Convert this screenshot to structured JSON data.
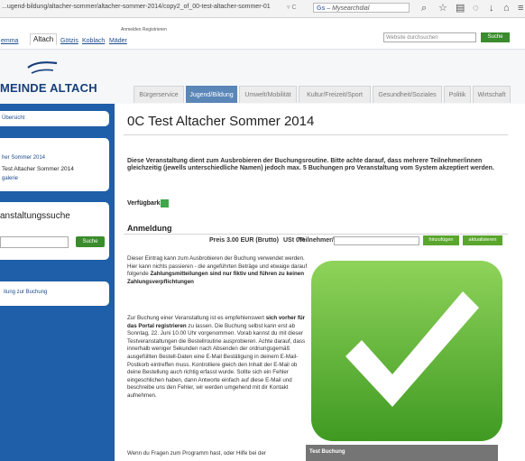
{
  "browser": {
    "url": "...ugend-bildung/altacher-sommer/altacher-sommer-2014/copy2_of_00-test-altacher-sommer-01",
    "search_placeholder": "Mysearchdial",
    "search_prefix": "Gs",
    "addr_controls": "▿ C",
    "toolbar_icons": [
      "search-icon",
      "star-icon",
      "clipboard-icon",
      "shield-icon",
      "download-icon",
      "home-icon",
      "menu-icon"
    ]
  },
  "top_links": {
    "partial": "emma",
    "altach": "Altach",
    "goetzis": "Götzis",
    "koblach": "Koblach",
    "mader": "Mäder",
    "account": "Anmelden   Registrieren",
    "search_placeholder": "Website durchsuchen",
    "search_button": "Suche"
  },
  "logo": {
    "text": "MEINDE ALTACH"
  },
  "nav": [
    {
      "label": "Bürgerservice",
      "active": false
    },
    {
      "label": "Jugend/Bildung",
      "active": true
    },
    {
      "label": "Umwelt/Mobilität",
      "active": false
    },
    {
      "label": "Kultur/Freizeit/Sport",
      "active": false
    },
    {
      "label": "Gesundheit/Soziales",
      "active": false
    },
    {
      "label": "Politik",
      "active": false
    },
    {
      "label": "Wirtschaft",
      "active": false
    }
  ],
  "sidebar": {
    "overview": "Übersicht",
    "items": [
      "her Sommer 2014",
      "Test Altacher Sommer 2014",
      "galerie"
    ],
    "search_title": "anstaltungssuche",
    "search_button": "Suche",
    "guide": "itung zur Buchung"
  },
  "main": {
    "title": "0C Test Altacher Sommer 2014",
    "intro": "Diese Veranstaltung dient zum Ausbrobieren der Buchungsroutine. Bitte achte darauf, dass mehrere Teilnehmer/innen gleichzeitig (jewells unterschiedliche Namen) jedoch max. 5 Buchungen pro Veranstaltung vom System akzeptiert werden.",
    "availability_label": "Verfügbarkeit",
    "registration_title": "Anmeldung",
    "price": "Preis 3.00 EUR (Brutto)",
    "vat": "USt 0%",
    "participant_label": "Teilnehmer/in",
    "add_button": "hinzufügen",
    "update_button": "aktualisieren",
    "para1_a": "Dieser Eintrag kann zum Ausbrobieren der Buchung verwendet werden. Hier kann nichts passieren - die angeführten Beträge und etwaige darauf folgende ",
    "para1_b": "Zahlungsmitteilungen sind nur fiktiv und führen zu keinen Zahlungsverpflichtungen",
    "para2_a": "Zur Buchung einer Veranstaltung ist es empfehlenswert ",
    "para2_b": "sich vorher für das Portal registrieren",
    "para2_c": " zu lassen. Die Buchung selbst kann erst ab Sonntag, 22. Juni 10.00 Uhr vorgenommen. Vorab kannst du mit dieser Testveranstaltungen die Bestellroutine ausprobieren. Achte darauf, dass innerhalb weniger Sekunden nach Absenden der ordnungsgemäß ausgefüllten Bestell-Daten eine E-Mail Bestätigung in deinem E-Mail-Postkorb eintreffen muss. Kontrolliere gleich den Inhalt der E-Mail ob deine Bestellung auch richtig erfasst wurde. Sollte sich ein Fehler eingeschlichen haben, dann Antworte einfach auf diese E-Mail und beschreibe uns den Fehler, wir werden umgehend mit dir Kontakt aufnehmen.",
    "para3": "Wenn du Fragen zum Programm hast, oder Hilfe bei der",
    "image_caption": "Test Buchung"
  },
  "colors": {
    "brand_blue": "#1f5ea8",
    "nav_active": "#5a86b8",
    "button_green": "#5aa62d",
    "availability_green": "#3fa64a"
  }
}
